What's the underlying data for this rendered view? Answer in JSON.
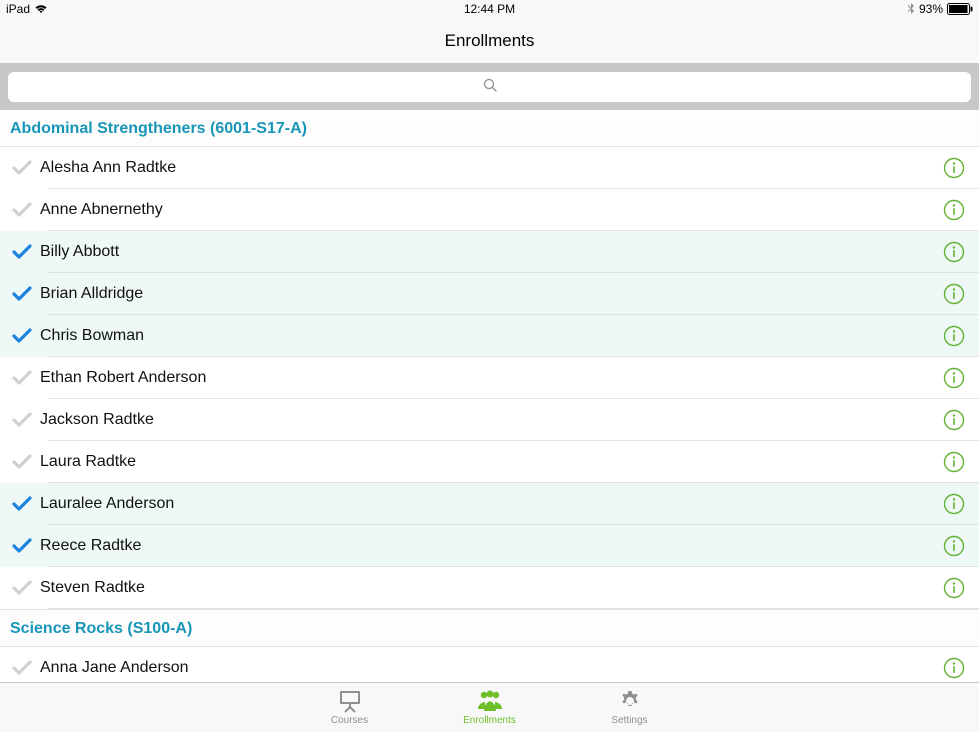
{
  "status": {
    "device": "iPad",
    "time": "12:44 PM",
    "battery_percent": "93%"
  },
  "nav": {
    "title": "Enrollments"
  },
  "search": {
    "placeholder": ""
  },
  "sections": [
    {
      "title": "Abdominal Strengtheners  (6001-S17-A)",
      "students": [
        {
          "name": "Alesha Ann Radtke",
          "checked": false
        },
        {
          "name": "Anne Abnernethy",
          "checked": false
        },
        {
          "name": "Billy Abbott",
          "checked": true
        },
        {
          "name": "Brian Alldridge",
          "checked": true
        },
        {
          "name": "Chris Bowman",
          "checked": true
        },
        {
          "name": "Ethan Robert Anderson",
          "checked": false
        },
        {
          "name": "Jackson Radtke",
          "checked": false
        },
        {
          "name": "Laura Radtke",
          "checked": false
        },
        {
          "name": "Lauralee Anderson",
          "checked": true
        },
        {
          "name": "Reece Radtke",
          "checked": true
        },
        {
          "name": "Steven Radtke",
          "checked": false
        }
      ]
    },
    {
      "title": "Science Rocks  (S100-A)",
      "students": [
        {
          "name": "Anna Jane Anderson",
          "checked": false
        }
      ]
    }
  ],
  "tabs": {
    "courses": "Courses",
    "enrollments": "Enrollments",
    "settings": "Settings"
  },
  "colors": {
    "accent_teal": "#1896b8",
    "check_blue": "#1c82e0",
    "check_gray": "#d0d0d0",
    "info_green": "#63b233",
    "tab_active": "#6fbf2a",
    "tab_inactive": "#8e8e93"
  }
}
